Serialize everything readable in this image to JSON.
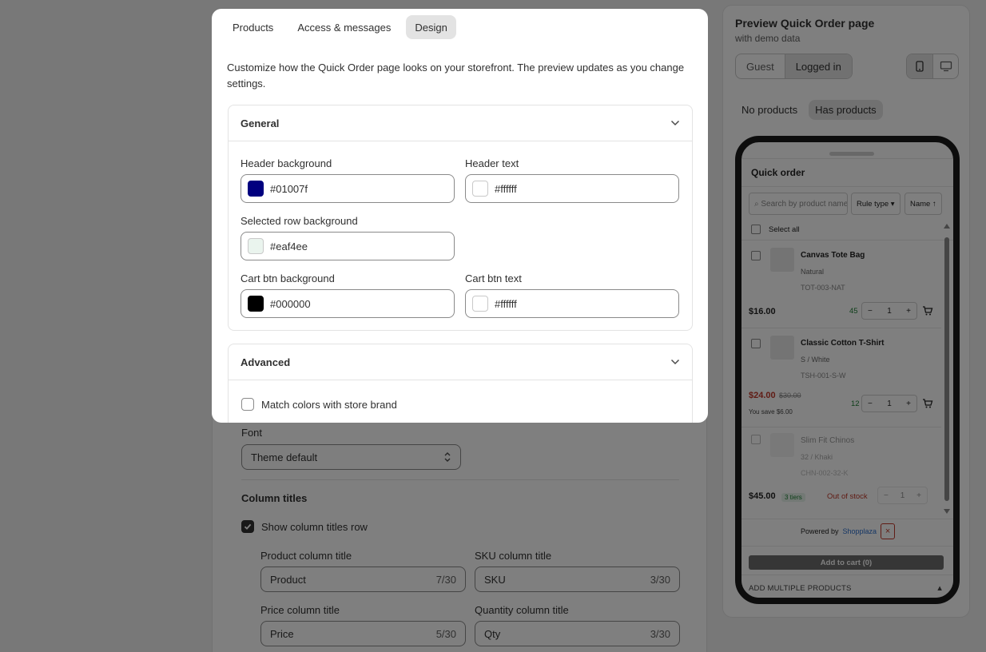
{
  "base": {
    "font_label": "Font",
    "font_value": "Theme default",
    "column_titles_heading": "Column titles",
    "show_column_titles_label": "Show column titles row",
    "product_col_label": "Product column title",
    "product_col_value": "Product",
    "product_col_count": "7/30",
    "sku_col_label": "SKU column title",
    "sku_col_value": "SKU",
    "sku_col_count": "3/30",
    "price_col_label": "Price column title",
    "price_col_value": "Price",
    "price_col_count": "5/30",
    "qty_col_label": "Quantity column title",
    "qty_col_value": "Qty",
    "qty_col_count": "3/30"
  },
  "preview": {
    "title": "Preview Quick Order page",
    "subtitle": "with demo data",
    "user_toggle": [
      "Guest",
      "Logged in"
    ],
    "user_active": "Logged in",
    "device_icons": [
      "mobile-icon",
      "desktop-icon"
    ],
    "data_toggle": [
      "No products",
      "Has products"
    ],
    "data_active": "Has products",
    "phone": {
      "title": "Quick order",
      "search_placeholder": "⌕ Search by product name",
      "filter_rule": "Rule type ▾",
      "filter_sort": "Name ↑",
      "select_all": "Select all",
      "items": [
        {
          "name": "Canvas Tote Bag",
          "variant": "Natural",
          "sku": "TOT-003-NAT",
          "price": "$16.00",
          "stock": "45",
          "qty": "1"
        },
        {
          "name": "Classic Cotton T-Shirt",
          "variant": "S / White",
          "sku": "TSH-001-S-W",
          "price": "$24.00",
          "compare_price": "$30.00",
          "savings": "You save $6.00",
          "stock": "12",
          "qty": "1"
        },
        {
          "name": "Slim Fit Chinos",
          "variant": "32 / Khaki",
          "sku": "CHN-002-32-K",
          "price": "$45.00",
          "tiers": "3 tiers",
          "stock": "Out of stock",
          "qty": "1"
        }
      ],
      "powered_by": "Powered by",
      "powered_brand": "Shopplaza",
      "add_to_cart": "Add to cart (0)",
      "add_multiple": "ADD MULTIPLE PRODUCTS",
      "add_multiple_arrow": "▲"
    }
  },
  "modal": {
    "tabs": [
      "Products",
      "Access & messages",
      "Design"
    ],
    "active_tab": "Design",
    "intro": "Customize how the Quick Order page looks on your storefront. The preview updates as you change settings.",
    "general": {
      "title": "General",
      "header_bg_label": "Header background",
      "header_bg_value": "#01007f",
      "header_text_label": "Header text",
      "header_text_value": "#ffffff",
      "selected_row_label": "Selected row background",
      "selected_row_value": "#eaf4ee",
      "cart_bg_label": "Cart btn background",
      "cart_bg_value": "#000000",
      "cart_text_label": "Cart btn text",
      "cart_text_value": "#ffffff"
    },
    "advanced": {
      "title": "Advanced",
      "match_colors_label": "Match colors with store brand"
    }
  },
  "colors": {
    "header_bg": "#01007f",
    "header_text": "#ffffff",
    "selected_row": "#eaf4ee",
    "cart_bg": "#000000",
    "cart_text": "#ffffff",
    "stock_green": "#1e7e34",
    "sale_red": "#c0392b"
  }
}
